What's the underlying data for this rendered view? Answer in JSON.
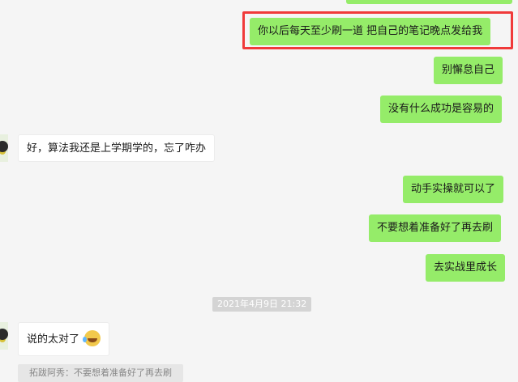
{
  "chat": {
    "messages": [
      {
        "side": "out",
        "text": "你以后每天至少刷一道 把自己的笔记晚点发给我",
        "highlighted": true
      },
      {
        "side": "out",
        "text": "别懈怠自己"
      },
      {
        "side": "out",
        "text": "没有什么成功是容易的"
      },
      {
        "side": "in",
        "text": "好，算法我还是上学期学的，忘了咋办"
      },
      {
        "side": "out",
        "text": "动手实操就可以了"
      },
      {
        "side": "out",
        "text": "不要想着准备好了再去刷"
      },
      {
        "side": "out",
        "text": "去实战里成长"
      },
      {
        "side": "in",
        "text": "说的太对了",
        "emoji": "grinning-sweat-emoji"
      }
    ],
    "timestamp": "2021年4月9日 21:32",
    "quote": "拓跋阿秀：不要想着准备好了再去刷"
  },
  "colors": {
    "background": "#f5f5f5",
    "outgoing_bubble": "#95ec69",
    "incoming_bubble": "#ffffff",
    "highlight_border": "#f03a3a"
  }
}
